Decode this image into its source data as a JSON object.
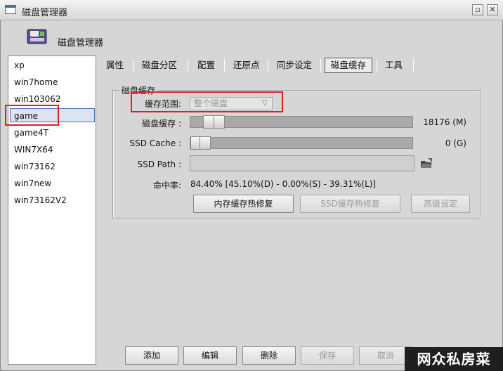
{
  "window": {
    "title": "磁盘管理器"
  },
  "header": {
    "title": "磁盘管理器"
  },
  "profiles": [
    "xp",
    "win7home",
    "win103062",
    "game",
    "game4T",
    "WIN7X64",
    "win73162",
    "win7new",
    "win73162V2"
  ],
  "selected_profile": "game",
  "tabs": [
    "属性",
    "磁盘分区",
    "配置",
    "还原点",
    "同步设定",
    "磁盘缓存",
    "工具"
  ],
  "active_tab": "磁盘缓存",
  "cache": {
    "group_title": "磁盘缓存",
    "range_label": "缓存范围:",
    "range_value": "整个磁盘",
    "disk_cache_label": "磁盘缓存 :",
    "disk_cache_value": "18176  (M)",
    "ssd_cache_label": "SSD Cache :",
    "ssd_cache_value": "0  (G)",
    "ssd_path_label": "SSD Path :",
    "ssd_path_value": "",
    "hit_rate_label": "命中率:",
    "hit_rate_value": "84.40% [45.10%(D) - 0.00%(S) - 39.31%(L)]",
    "btn_mem_repair": "内存缓存热修复",
    "btn_ssd_repair": "SSD缓存热修复",
    "btn_advanced": "高级设定"
  },
  "bottom_buttons": {
    "add": "添加",
    "edit": "编辑",
    "delete": "删除",
    "save": "保存",
    "cancel": "取消"
  },
  "watermark": "网众私房菜",
  "colors": {
    "highlight": "#e02020",
    "selection": "#4d6fb8"
  }
}
